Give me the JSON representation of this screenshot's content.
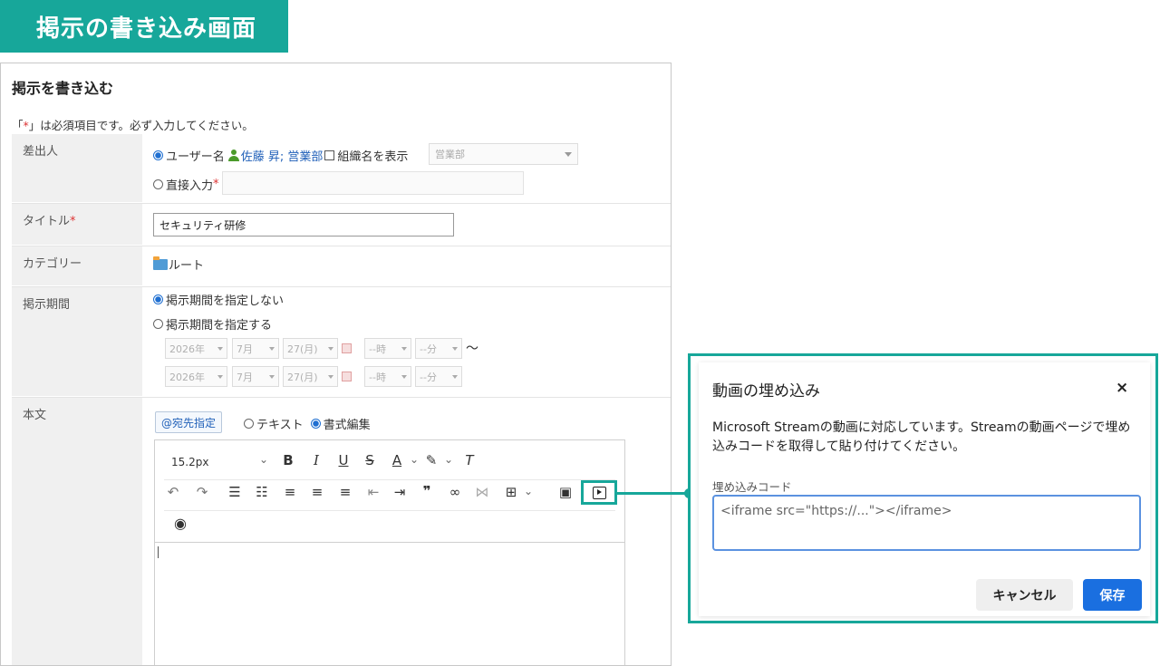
{
  "banner": {
    "title": "掲示の書き込み画面"
  },
  "form": {
    "title": "掲示を書き込む",
    "required_note_prefix": "「",
    "required_note_star": "*",
    "required_note_suffix": "」は必須項目です。必ず入力してください。",
    "sender": {
      "label": "差出人",
      "username_option": "ユーザー名",
      "user_link": "佐藤 昇; 営業部",
      "show_org_label": "組織名を表示",
      "org_select_value": "営業部",
      "direct_input_option": "直接入力",
      "required_star": "*"
    },
    "title_field": {
      "label": "タイトル",
      "required_star": "*",
      "value": "セキュリティ研修"
    },
    "category": {
      "label": "カテゴリー",
      "value": "ルート"
    },
    "period": {
      "label": "掲示期間",
      "option_no_period": "掲示期間を指定しない",
      "option_set_period": "掲示期間を指定する",
      "start": {
        "year": "2026年",
        "month": "7月",
        "day": "27(月)",
        "hour": "--時",
        "minute": "--分"
      },
      "end": {
        "year": "2026年",
        "month": "7月",
        "day": "27(月)",
        "hour": "--時",
        "minute": "--分"
      },
      "tilde": "〜"
    },
    "body": {
      "label": "本文",
      "mention_button": "@宛先指定",
      "option_text": "テキスト",
      "option_rich": "書式編集",
      "font_size": "15.2px"
    }
  },
  "toolbar_icons": [
    "chevron-down",
    "bold",
    "italic",
    "underline",
    "strikethrough",
    "font-color",
    "highlight",
    "clear-format",
    "undo",
    "redo",
    "bullet-list",
    "numbered-list",
    "align-left",
    "align-center",
    "align-right",
    "outdent",
    "indent",
    "quote",
    "link",
    "unlink",
    "table",
    "image",
    "video-embed",
    "preview"
  ],
  "dialog": {
    "title": "動画の埋め込み",
    "close_symbol": "×",
    "description": "Microsoft Streamの動画に対応しています。Streamの動画ページで埋め込みコードを取得して貼り付けてください。",
    "code_label": "埋め込みコード",
    "code_value": "<iframe src=\"https://...\"></iframe>",
    "cancel_button": "キャンセル",
    "save_button": "保存"
  },
  "colors": {
    "accent_teal": "#17a79a",
    "link_blue": "#1f5fb8",
    "primary_button": "#1a6fe0",
    "required_red": "#d33333"
  }
}
